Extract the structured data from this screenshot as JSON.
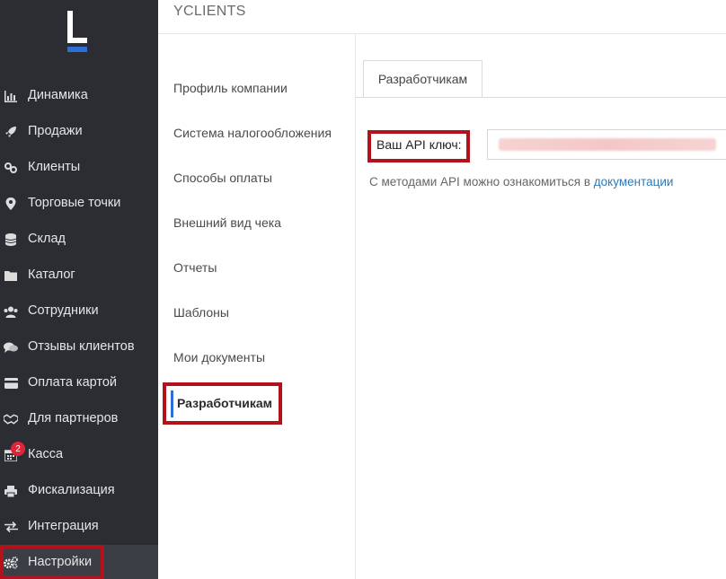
{
  "company_name": "YCLIENTS",
  "sidebar": {
    "items": [
      {
        "label": "Динамика",
        "icon": "bar-chart-icon"
      },
      {
        "label": "Продажи",
        "icon": "rocket-icon"
      },
      {
        "label": "Клиенты",
        "icon": "link-icon"
      },
      {
        "label": "Торговые точки",
        "icon": "map-pin-icon"
      },
      {
        "label": "Склад",
        "icon": "database-icon"
      },
      {
        "label": "Каталог",
        "icon": "folder-icon"
      },
      {
        "label": "Сотрудники",
        "icon": "users-icon"
      },
      {
        "label": "Отзывы клиентов",
        "icon": "comments-icon"
      },
      {
        "label": "Оплата картой",
        "icon": "credit-card-icon"
      },
      {
        "label": "Для партнеров",
        "icon": "handshake-icon"
      },
      {
        "label": "Касса",
        "icon": "calendar-icon",
        "badge": "2"
      },
      {
        "label": "Фискализация",
        "icon": "printer-icon"
      },
      {
        "label": "Интеграция",
        "icon": "exchange-icon"
      },
      {
        "label": "Настройки",
        "icon": "gears-icon",
        "active": true
      }
    ]
  },
  "settings_menu": {
    "items": [
      "Профиль компании",
      "Система налогообложения",
      "Способы оплаты",
      "Внешний вид чека",
      "Отчеты",
      "Шаблоны",
      "Мои документы"
    ],
    "active": "Разработчикам"
  },
  "content": {
    "tab": "Разработчикам",
    "api_label": "Ваш API ключ:",
    "api_note_prefix": "С методами API можно ознакомиться в ",
    "api_note_link": "документации"
  },
  "colors": {
    "sidebar_bg": "#2b2d32",
    "accent_blue": "#2d6fd6",
    "highlight_red": "#b3121b",
    "badge_red": "#e0243a",
    "link": "#2f7ab8"
  }
}
